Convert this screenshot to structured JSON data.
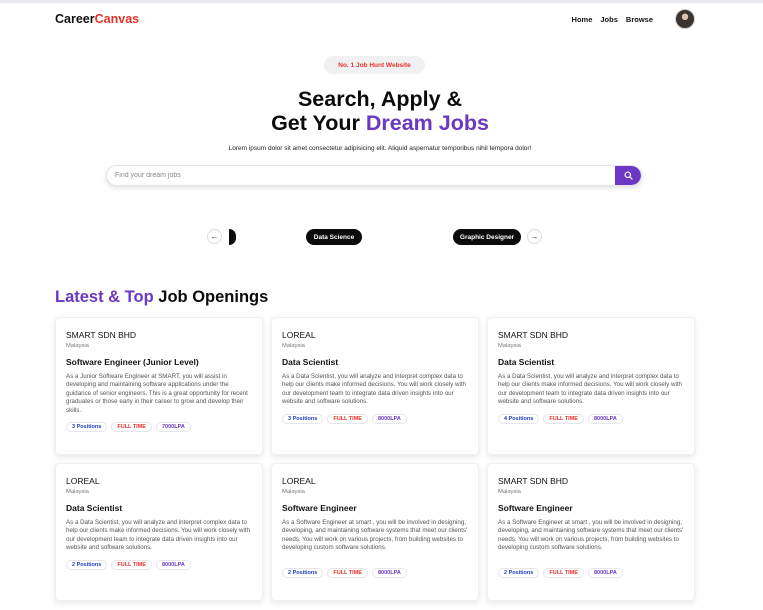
{
  "brand": {
    "part1": "Career",
    "part2": "Canvas",
    "accent_color": "#e8322a"
  },
  "nav": {
    "links": [
      "Home",
      "Jobs",
      "Browse"
    ],
    "avatar_icon": "user-avatar"
  },
  "hero": {
    "badge": "No. 1 Job Hunt Website",
    "title_line1": "Search, Apply &",
    "title_line2_prefix": "Get Your ",
    "title_line2_highlight": "Dream Jobs",
    "subtitle": "Lorem ipsum dolor sit amet consectetur adipisicing elit. Aliquid aspernatur temporibus nihil tempora dolor!",
    "search_placeholder": "Find your dream jobs",
    "search_icon": "search-icon",
    "highlight_color": "#6a38c2"
  },
  "carousel": {
    "prev_icon": "arrow-left-icon",
    "next_icon": "arrow-right-icon",
    "categories": [
      "Data Science",
      "Graphic Designer"
    ]
  },
  "section": {
    "title_highlight": "Latest & Top",
    "title_rest": " Job Openings"
  },
  "jobs": [
    {
      "company": "SMART SDN BHD",
      "location": "Malaysia",
      "title": "Software Engineer (Junior Level)",
      "description": "As a Junior Software Engineer at SMART, you will assist in developing and maintaining software applications under the guidance of senior engineers. This is a great opportunity for recent graduates or those early in their career to grow and develop their skills.",
      "positions": "3 Positions",
      "type": "FULL TIME",
      "salary": "7000LPA"
    },
    {
      "company": "LOREAL",
      "location": "Malaysia",
      "title": "Data Scientist",
      "description": "As a Data Scientist, you will analyze and interpret complex data to help our clients make informed decisions. You will work closely with our development team to integrate data driven insights into our website and software solutions.",
      "positions": "3 Positions",
      "type": "FULL TIME",
      "salary": "8000LPA"
    },
    {
      "company": "SMART SDN BHD",
      "location": "Malaysia",
      "title": "Data Scientist",
      "description": "As a Data Scientist, you will analyze and interpret complex data to help our clients make informed decisions. You will work closely with our development team to integrate data driven insights into our website and software solutions.",
      "positions": "4 Positions",
      "type": "FULL TIME",
      "salary": "8000LPA"
    },
    {
      "company": "LOREAL",
      "location": "Malaysia",
      "title": "Data Scientist",
      "description": "As a Data Scientist, you will analyze and interpret complex data to help our clients make informed decisions. You will work closely with our development team to integrate data driven insights into our website and software solutions.",
      "positions": "2 Positions",
      "type": "FULL TIME",
      "salary": "8000LPA"
    },
    {
      "company": "LOREAL",
      "location": "Malaysia",
      "title": "Software Engineer",
      "description": "As a Software Engineer at smart , you will be involved in designing, developing, and maintaining software systems that meet our clients' needs. You will work on various projects, from building websites to developing custom software solutions.",
      "positions": "2 Positions",
      "type": "FULL TIME",
      "salary": "8000LPA"
    },
    {
      "company": "SMART SDN BHD",
      "location": "Malaysia",
      "title": "Software Engineer",
      "description": "As a Software Engineer at smart , you will be involved in designing, developing, and maintaining software systems that meet our clients' needs. You will work on various projects, from building websites to developing custom software solutions.",
      "positions": "2 Positions",
      "type": "FULL TIME",
      "salary": "8000LPA"
    }
  ]
}
